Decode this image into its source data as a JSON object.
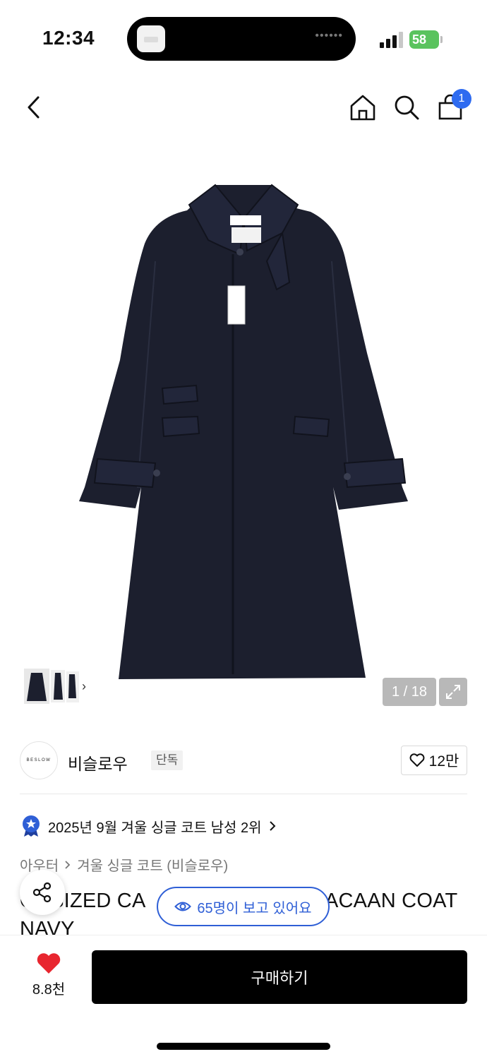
{
  "status_bar": {
    "time": "12:34",
    "battery": "58"
  },
  "nav": {
    "cart_count": "1",
    "icons": [
      "chevron-left-icon",
      "home-icon",
      "search-icon",
      "shopping-bag-icon"
    ]
  },
  "gallery": {
    "counter": "1 / 18",
    "thumb_arrow": "›"
  },
  "brand": {
    "logo_text": "BESLOW",
    "name": "비슬로우",
    "tag": "단독",
    "like_count": "12만"
  },
  "ranking": {
    "text": "2025년 9월 겨울 싱글 코트 남성 2위"
  },
  "breadcrumb": {
    "category": "아우터",
    "subcategory": "겨울 싱글 코트 (비슬로우)"
  },
  "product": {
    "title_line1_left": "O",
    "title_line1_mid": "RSIZED CA",
    "title_line1_right": "ACAAN COAT",
    "title_line2": "NAVY"
  },
  "viewers": {
    "text": "65명이 보고 있어요"
  },
  "bottom_bar": {
    "heart_count": "8.8천",
    "buy_label": "구매하기"
  },
  "colors": {
    "accent_blue": "#2f5fd6",
    "badge_blue": "#2e6bf0",
    "heart_red": "#e8262f",
    "battery_green": "#5ac35e",
    "coat_navy": "#1c1f2e"
  }
}
